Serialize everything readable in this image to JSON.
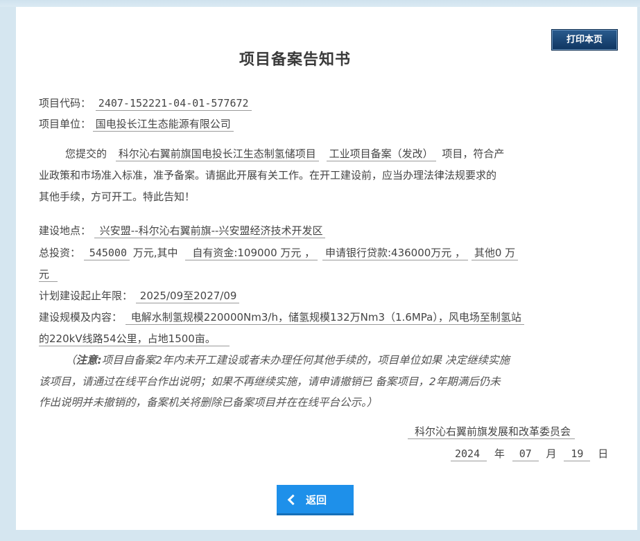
{
  "print_button": "打印本页",
  "title": "项目备案告知书",
  "project_code": {
    "label": "项目代码：",
    "value": "2407-152221-04-01-577672"
  },
  "project_unit": {
    "label": "项目单位：",
    "value": "国电投长江生态能源有限公司"
  },
  "body": {
    "prefix": "您提交的",
    "project_name": "科尔沁右翼前旗国电投长江生态制氢储项目",
    "project_type": "工业项目备案（发改）",
    "line1_end": "项目，符合产",
    "line2": "业政策和市场准入标准，准予备案。请据此开展有关工作。在开工建设前，应当办理法律法规要求的",
    "line3": "其他手续，方可开工。特此告知！"
  },
  "location": {
    "label": "建设地点：",
    "value": "兴安盟--科尔沁右翼前旗--兴安盟经济技术开发区"
  },
  "investment": {
    "label": "总投资：",
    "total": "545000",
    "mid": "万元,其中",
    "own": "自有资金:109000 万元 ，",
    "loan": "申请银行贷款:436000万元 ，",
    "other": "其他0 万",
    "other_cont": "元"
  },
  "period": {
    "label": "计划建设起止年限：",
    "value": "2025/09至2027/09"
  },
  "scale": {
    "label": "建设规模及内容：",
    "line1": "电解水制氢规模220000Nm3/h，储氢规模132万Nm3（1.6MPa），风电场至制氢站",
    "line2": "的220kV线路54公里，占地1500亩。"
  },
  "note": {
    "open": "（",
    "bold": "注意:",
    "line1": "项目自备案2年内未开工建设或者未办理任何其他手续的，项目单位如果 决定继续实施",
    "line2": "该项目，请通过在线平台作出说明；如果不再继续实施，请申请撤销已 备案项目，2年期满后仍未",
    "line3": "作出说明并未撤销的，备案机关将删除已备案项目并在在线平台公示。）"
  },
  "signature": {
    "org": "科尔沁右翼前旗发展和改革委员会",
    "year": "2024",
    "year_unit": "年",
    "month": "07",
    "month_unit": "月",
    "day": "19",
    "day_unit": "日"
  },
  "back_button": "返回"
}
